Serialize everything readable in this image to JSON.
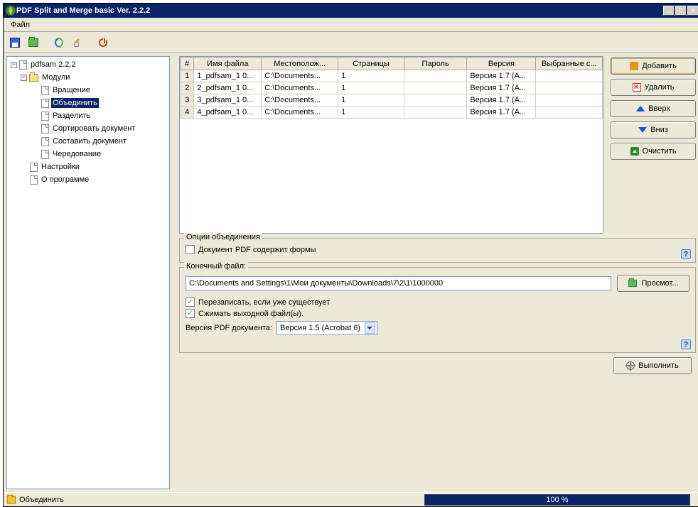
{
  "window": {
    "title": "PDF Split and Merge basic Ver. 2.2.2"
  },
  "menu": {
    "file": "Файл"
  },
  "tree": {
    "root": "pdfsam 2.2.2",
    "modules": "Модули",
    "items": {
      "rotate": "Вращение",
      "merge": "Объединить",
      "split": "Разделить",
      "sort": "Сортировать документ",
      "compose": "Составить документ",
      "alternate": "Чередование"
    },
    "settings": "Настройки",
    "about": "О программе"
  },
  "table": {
    "headers": {
      "num": "#",
      "file": "Имя файла",
      "loc": "Местополож...",
      "pages": "Страницы",
      "pass": "Пароль",
      "ver": "Версия",
      "sel": "Выбранные с..."
    },
    "rows": [
      {
        "n": "1",
        "file": "1_pdfsam_1 0...",
        "loc": "C:\\Documents...",
        "pages": "1",
        "pass": "",
        "ver": "Версия 1.7 (A...",
        "sel": ""
      },
      {
        "n": "2",
        "file": "2_pdfsam_1 0...",
        "loc": "C:\\Documents...",
        "pages": "1",
        "pass": "",
        "ver": "Версия 1.7 (A...",
        "sel": ""
      },
      {
        "n": "3",
        "file": "3_pdfsam_1 0...",
        "loc": "C:\\Documents...",
        "pages": "1",
        "pass": "",
        "ver": "Версия 1.7 (A...",
        "sel": ""
      },
      {
        "n": "4",
        "file": "4_pdfsam_1 0...",
        "loc": "C:\\Documents...",
        "pages": "1",
        "pass": "",
        "ver": "Версия 1.7 (A...",
        "sel": ""
      }
    ]
  },
  "buttons": {
    "add": "Добавить",
    "delete": "Удалить",
    "up": "Вверх",
    "down": "Вниз",
    "clear": "Очистить",
    "browse": "Просмот...",
    "run": "Выполнить"
  },
  "options": {
    "legend": "Опции объединения",
    "forms": "Документ PDF содержит формы"
  },
  "output": {
    "legend": "Конечный файл:",
    "path": "C:\\Documents and Settings\\1\\Мои документы\\Downloads\\7\\2\\1\\1000000",
    "overwrite": "Перезаписать, если уже существует",
    "compress": "Сжимать выходной файл(ы).",
    "version_label": "Версия PDF документа:",
    "version_value": "Версия 1.5 (Acrobat 6)"
  },
  "status": {
    "task": "Объединить",
    "progress": "100 %"
  }
}
